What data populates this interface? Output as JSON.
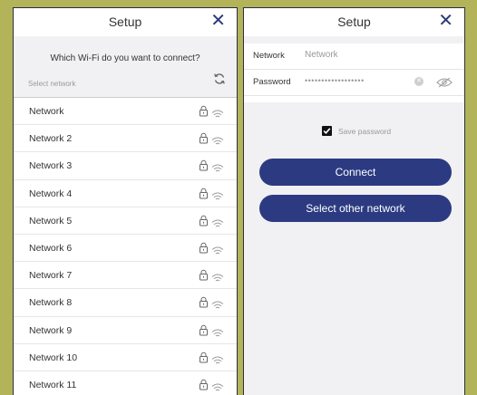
{
  "left": {
    "title": "Setup",
    "close": "✕",
    "question": "Which Wi-Fi do you want to connect?",
    "select_label": "Select network",
    "networks": [
      {
        "name": "Network"
      },
      {
        "name": "Network 2"
      },
      {
        "name": "Network 3"
      },
      {
        "name": "Network 4"
      },
      {
        "name": "Network 5"
      },
      {
        "name": "Network 6"
      },
      {
        "name": "Network 7"
      },
      {
        "name": "Network 8"
      },
      {
        "name": "Network 9"
      },
      {
        "name": "Network 10"
      },
      {
        "name": "Network 11"
      }
    ]
  },
  "right": {
    "title": "Setup",
    "close": "✕",
    "network_label": "Network",
    "network_value": "Network",
    "password_label": "Password",
    "password_dots": "••••••••••••••••••",
    "save_password_label": "Save password",
    "save_password_checked": true,
    "connect_label": "Connect",
    "select_other_label": "Select other network"
  },
  "colors": {
    "background": "#b3b35a",
    "accent": "#2c3b81"
  },
  "icons": {
    "refresh": "refresh-icon",
    "lock": "lock-icon",
    "wifi": "wifi-icon",
    "clear": "clear-icon",
    "eye": "eye-slash-icon",
    "check": "checkmark-icon"
  }
}
